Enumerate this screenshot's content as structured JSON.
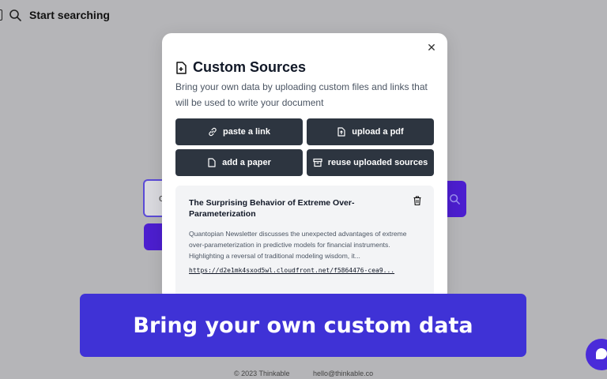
{
  "topbar": {
    "title": "Start searching",
    "icon": "search-icon"
  },
  "background": {
    "input_char": "c"
  },
  "modal": {
    "title": "Custom Sources",
    "description": "Bring your own data by uploading custom files and links that will be used to write your document",
    "buttons": {
      "paste_link": "paste a link",
      "upload_pdf": "upload a pdf",
      "add_paper": "add a paper",
      "reuse_sources": "reuse uploaded sources"
    },
    "source": {
      "title": "The Surprising Behavior of Extreme Over-Parameterization",
      "description": "Quantopian Newsletter discusses the unexpected advantages of extreme over-parameterization in predictive models for financial instruments. Highlighting a reversal of traditional modeling wisdom, it...",
      "link": "https://d2e1mk4sxod5wl.cloudfront.net/f5864476-cea9..."
    }
  },
  "banner": {
    "text": "Bring your own custom data"
  },
  "footer": {
    "copyright": "© 2023 Thinkable",
    "email": "hello@thinkable.co"
  },
  "colors": {
    "accent": "#4c1ecf",
    "banner": "#3f32d6",
    "button_dark": "#2d3540",
    "overlay": "#b5b5b8"
  }
}
